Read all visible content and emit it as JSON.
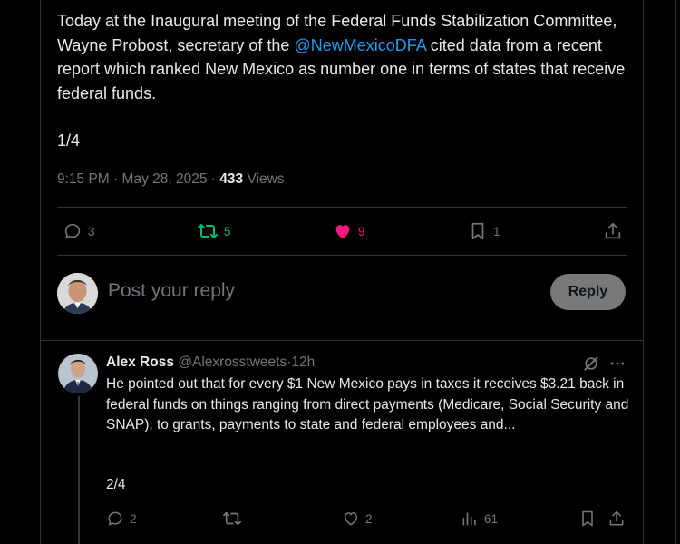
{
  "tweet": {
    "text_1": "Today at the Inaugural meeting of the Federal Funds Stabilization Committee, Wayne Probost, secretary of the ",
    "mention": "@NewMexicoDFA",
    "text_2": " cited data from a recent report which ranked New Mexico as number one in terms of states that receive federal funds.",
    "thread_count": "1/4",
    "time": "9:15 PM",
    "date": "May 28, 2025",
    "views_count": "433",
    "views_label": "Views",
    "sep": "·",
    "actions": {
      "replies": "3",
      "reposts": "5",
      "likes": "9",
      "bookmarks": "1"
    },
    "colors": {
      "repost": "#00ba7c",
      "like": "#f91880",
      "mention": "#1d9bf0"
    }
  },
  "composer": {
    "placeholder": "Post your reply",
    "reply_button": "Reply"
  },
  "reply": {
    "name": "Alex Ross",
    "handle": "@Alexrosstweets",
    "sep": "·",
    "time": "12h",
    "text": "He pointed out that for every $1 New Mexico pays in taxes it receives $3.21 back in federal funds on things ranging from direct payments (Medicare, Social Security and SNAP), to grants, payments to state and federal employees and...",
    "thread_count": "2/4",
    "actions": {
      "replies": "2",
      "reposts": "",
      "likes": "2",
      "views": "61"
    }
  }
}
